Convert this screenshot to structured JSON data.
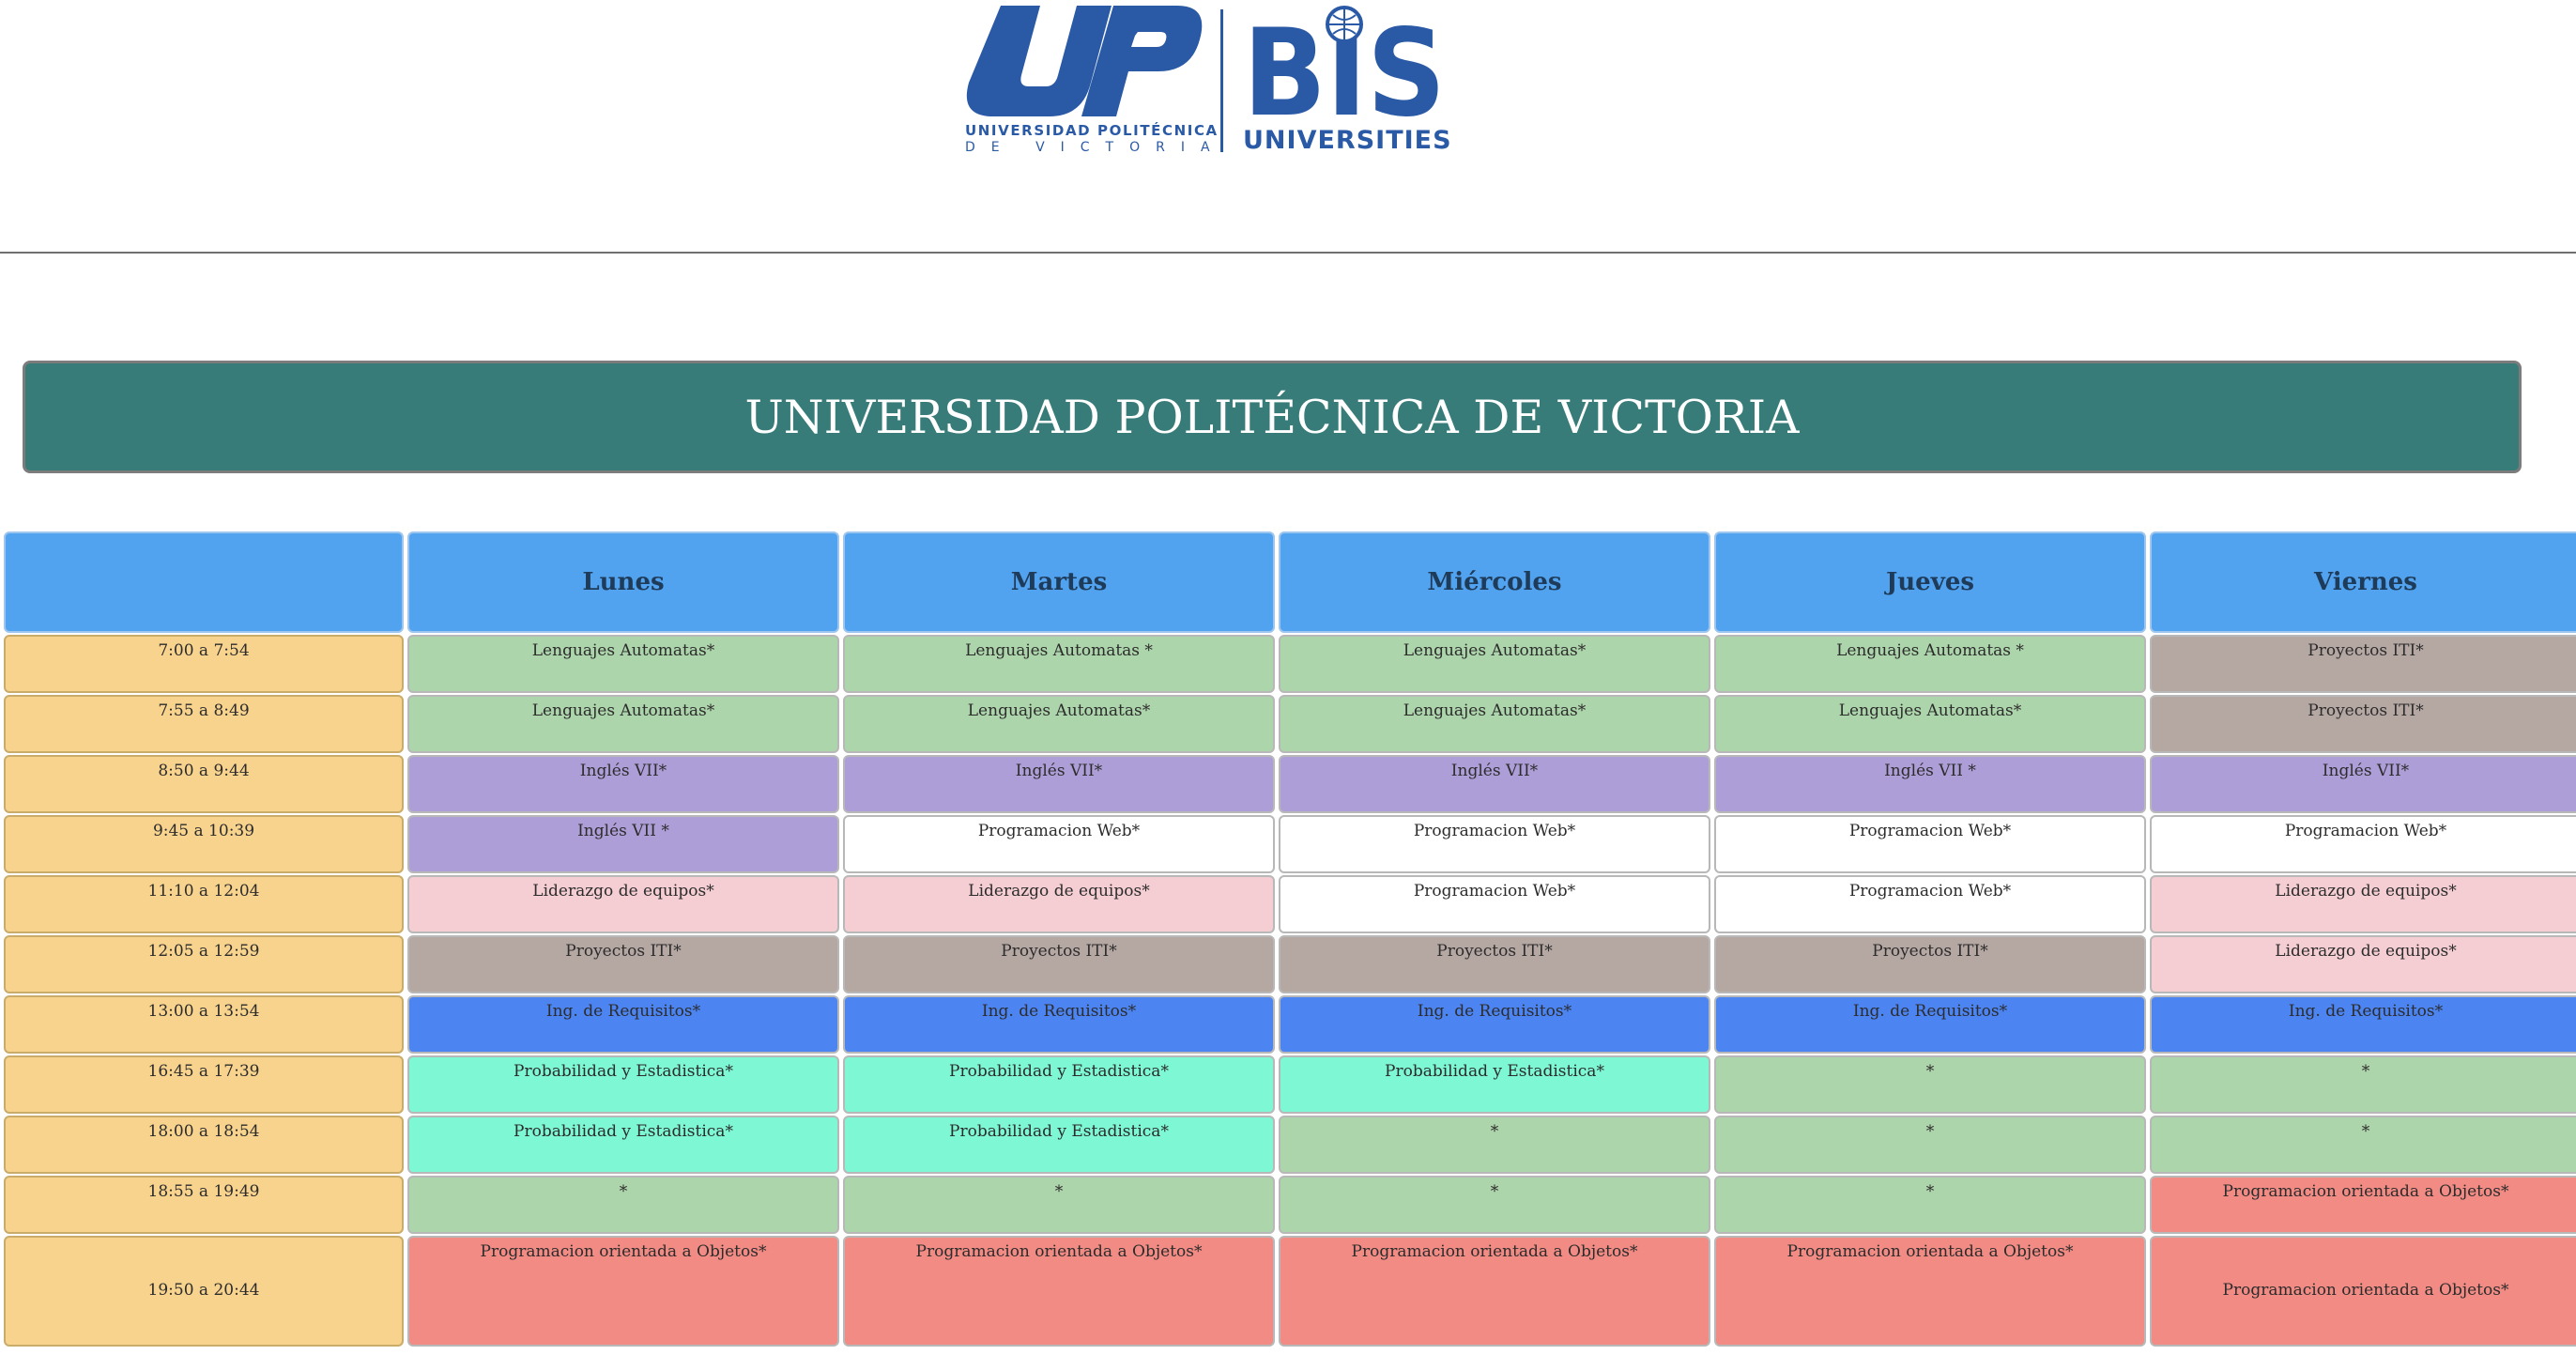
{
  "header": {
    "up_logo": {
      "letters": "UP",
      "line1": "UNIVERSIDAD POLITÉCNICA",
      "line2": "DE VICTORIA"
    },
    "bis_logo": {
      "letters": "BIS",
      "line": "UNIVERSITIES"
    },
    "brand_color": "#2a5aa6"
  },
  "banner": {
    "title": "UNIVERSIDAD POLITÉCNICA DE VICTORIA",
    "background_color": "#387c7a"
  },
  "schedule": {
    "days": [
      "Lunes",
      "Martes",
      "Miércoles",
      "Jueves",
      "Viernes"
    ],
    "colors": {
      "header": "#52a3ef",
      "time": "#f8d38e",
      "green": "#add5ab",
      "taupe": "#b5a8a3",
      "purple": "#ae9ed8",
      "white": "#ffffff",
      "pink": "#f5ced3",
      "blue": "#4c84f2",
      "aqua": "#7ef8d4",
      "salmon": "#f18b84"
    },
    "rows": [
      {
        "time": "7:00 a 7:54",
        "cells": [
          {
            "text": "Lenguajes Automatas*",
            "color": "green"
          },
          {
            "text": "Lenguajes Automatas *",
            "color": "green"
          },
          {
            "text": "Lenguajes Automatas*",
            "color": "green"
          },
          {
            "text": "Lenguajes Automatas *",
            "color": "green"
          },
          {
            "text": "Proyectos ITI*",
            "color": "taupe"
          }
        ]
      },
      {
        "time": "7:55 a 8:49",
        "cells": [
          {
            "text": "Lenguajes Automatas*",
            "color": "green"
          },
          {
            "text": "Lenguajes Automatas*",
            "color": "green"
          },
          {
            "text": "Lenguajes Automatas*",
            "color": "green"
          },
          {
            "text": "Lenguajes Automatas*",
            "color": "green"
          },
          {
            "text": "Proyectos ITI*",
            "color": "taupe"
          }
        ]
      },
      {
        "time": "8:50 a 9:44",
        "cells": [
          {
            "text": "Inglés VII*",
            "color": "purple"
          },
          {
            "text": "Inglés VII*",
            "color": "purple"
          },
          {
            "text": "Inglés VII*",
            "color": "purple"
          },
          {
            "text": "Inglés VII *",
            "color": "purple"
          },
          {
            "text": "Inglés VII*",
            "color": "purple"
          }
        ]
      },
      {
        "time": "9:45 a 10:39",
        "cells": [
          {
            "text": "Inglés VII *",
            "color": "purple"
          },
          {
            "text": "Programacion Web*",
            "color": "white"
          },
          {
            "text": "Programacion Web*",
            "color": "white"
          },
          {
            "text": "Programacion Web*",
            "color": "white"
          },
          {
            "text": "Programacion Web*",
            "color": "white"
          }
        ]
      },
      {
        "time": "11:10 a 12:04",
        "cells": [
          {
            "text": "Liderazgo de equipos*",
            "color": "pink"
          },
          {
            "text": "Liderazgo de equipos*",
            "color": "pink"
          },
          {
            "text": "Programacion Web*",
            "color": "white"
          },
          {
            "text": "Programacion Web*",
            "color": "white"
          },
          {
            "text": "Liderazgo de equipos*",
            "color": "pink"
          }
        ]
      },
      {
        "time": "12:05 a 12:59",
        "cells": [
          {
            "text": "Proyectos ITI*",
            "color": "taupe"
          },
          {
            "text": "Proyectos ITI*",
            "color": "taupe"
          },
          {
            "text": "Proyectos ITI*",
            "color": "taupe"
          },
          {
            "text": "Proyectos ITI*",
            "color": "taupe"
          },
          {
            "text": "Liderazgo de equipos*",
            "color": "pink"
          }
        ]
      },
      {
        "time": "13:00 a 13:54",
        "cells": [
          {
            "text": "Ing. de Requisitos*",
            "color": "blue"
          },
          {
            "text": "Ing. de Requisitos*",
            "color": "blue"
          },
          {
            "text": "Ing. de Requisitos*",
            "color": "blue"
          },
          {
            "text": "Ing. de Requisitos*",
            "color": "blue"
          },
          {
            "text": "Ing. de Requisitos*",
            "color": "blue"
          }
        ]
      },
      {
        "time": "16:45 a 17:39",
        "cells": [
          {
            "text": "Probabilidad y Estadistica*",
            "color": "aqua"
          },
          {
            "text": "Probabilidad y Estadistica*",
            "color": "aqua"
          },
          {
            "text": "Probabilidad y Estadistica*",
            "color": "aqua"
          },
          {
            "text": "*",
            "color": "green"
          },
          {
            "text": "*",
            "color": "green"
          }
        ]
      },
      {
        "time": "18:00 a 18:54",
        "cells": [
          {
            "text": "Probabilidad y Estadistica*",
            "color": "aqua"
          },
          {
            "text": "Probabilidad y Estadistica*",
            "color": "aqua"
          },
          {
            "text": "*",
            "color": "green"
          },
          {
            "text": "*",
            "color": "green"
          },
          {
            "text": "*",
            "color": "green"
          }
        ]
      },
      {
        "time": "18:55 a 19:49",
        "cells": [
          {
            "text": "*",
            "color": "green"
          },
          {
            "text": "*",
            "color": "green"
          },
          {
            "text": "*",
            "color": "green"
          },
          {
            "text": "*",
            "color": "green"
          },
          {
            "text": "Programacion orientada a Objetos*",
            "color": "salmon"
          }
        ]
      },
      {
        "time": "19:50 a 20:44",
        "tall": true,
        "cells": [
          {
            "text": "Programacion orientada a Objetos*",
            "color": "salmon"
          },
          {
            "text": "Programacion orientada a Objetos*",
            "color": "salmon"
          },
          {
            "text": "Programacion orientada a Objetos*",
            "color": "salmon"
          },
          {
            "text": "Programacion orientada a Objetos*",
            "color": "salmon"
          },
          {
            "text": "Programacion orientada a Objetos*",
            "color": "salmon",
            "valign": "middle"
          }
        ]
      }
    ]
  }
}
